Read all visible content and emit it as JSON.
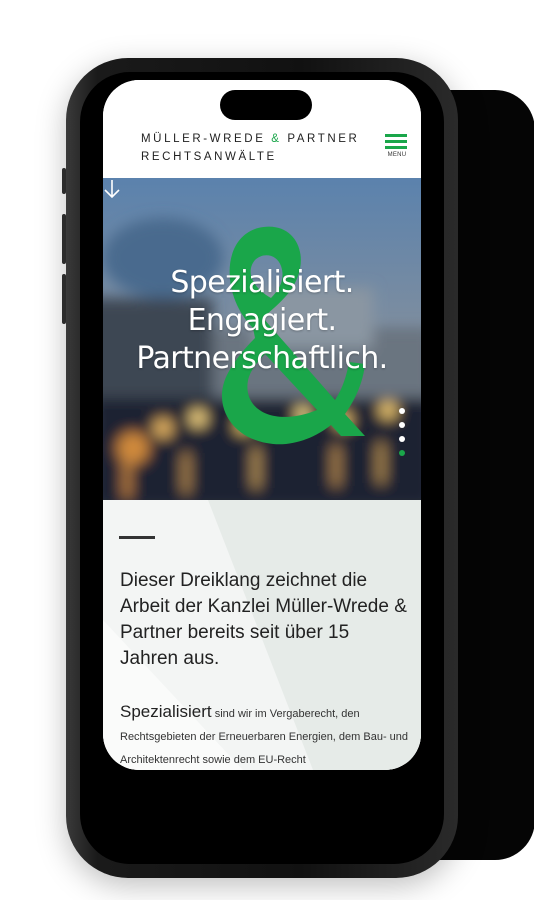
{
  "header": {
    "logo_line1_a": "MÜLLER-WREDE",
    "logo_amp": "&",
    "logo_line1_b": "PARTNER",
    "logo_line2": "RECHTSANWÄLTE",
    "menu_label": "MENU"
  },
  "hero": {
    "line1": "Spezialisiert.",
    "line2": "Engagiert.",
    "line3": "Partnerschaftlich.",
    "slides_total": 4,
    "active_slide": 4
  },
  "content": {
    "lead": "Dieser Dreiklang zeichnet die Arbeit der Kanzlei Müller-Wrede & Partner bereits seit über 15 Jahren aus.",
    "body_strong": "Spezialisiert",
    "body_rest": " sind wir im Vergaberecht, den Rechtsgebieten der Erneuerbaren Energien, dem Bau- und Architektenrecht sowie dem EU-Recht"
  },
  "colors": {
    "accent_green": "#1aa64a",
    "text_dark": "#222222"
  }
}
